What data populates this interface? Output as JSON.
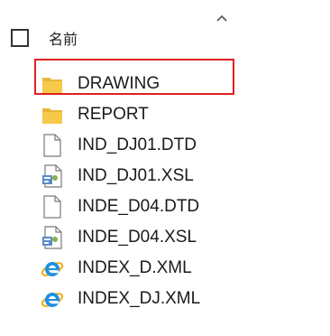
{
  "header": {
    "column_label": "名前",
    "sort_icon": "chevron-up-icon"
  },
  "files": [
    {
      "name": "DRAWING",
      "type": "folder",
      "icon": "folder-icon",
      "highlighted": true
    },
    {
      "name": "REPORT",
      "type": "folder",
      "icon": "folder-icon",
      "highlighted": false
    },
    {
      "name": "IND_DJ01.DTD",
      "type": "file",
      "icon": "document-icon",
      "highlighted": false
    },
    {
      "name": "IND_DJ01.XSL",
      "type": "xsl",
      "icon": "xsl-file-icon",
      "highlighted": false
    },
    {
      "name": "INDE_D04.DTD",
      "type": "file",
      "icon": "document-icon",
      "highlighted": false
    },
    {
      "name": "INDE_D04.XSL",
      "type": "xsl",
      "icon": "xsl-file-icon",
      "highlighted": false
    },
    {
      "name": "INDEX_D.XML",
      "type": "xml",
      "icon": "internet-explorer-icon",
      "highlighted": false
    },
    {
      "name": "INDEX_DJ.XML",
      "type": "xml",
      "icon": "internet-explorer-icon",
      "highlighted": false
    }
  ],
  "colors": {
    "highlight": "#e02020",
    "folder": "#f6c94a",
    "ie_blue": "#1e90e0"
  }
}
